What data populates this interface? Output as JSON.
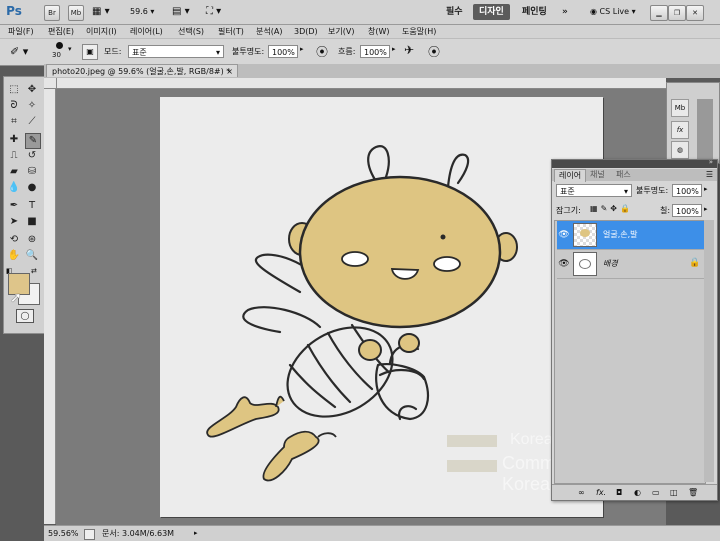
{
  "appbar": {
    "logo": "Ps",
    "br": "Br",
    "mb": "Mb",
    "zoom": "59.6",
    "workspaces": [
      "필수",
      "디자인",
      "페인팅"
    ],
    "active_workspace": "디자인",
    "more": "»",
    "cslive": "CS Live"
  },
  "menu": [
    "파일(F)",
    "편집(E)",
    "이미지(I)",
    "레이어(L)",
    "선택(S)",
    "필터(T)",
    "분석(A)",
    "3D(D)",
    "보기(V)",
    "창(W)",
    "도움말(H)"
  ],
  "options": {
    "brush_size": "30",
    "mode_label": "모드:",
    "mode_value": "표준",
    "opacity_label": "불투명도:",
    "opacity_value": "100%",
    "flow_label": "흐름:",
    "flow_value": "100%"
  },
  "document": {
    "tab_title": "photo20.jpeg @ 59.6% (얼굴,손,발, RGB/8#) *",
    "close": "×"
  },
  "status": {
    "zoom": "59.56%",
    "doc_size": "문서: 3.04M/6.63M"
  },
  "layers_panel": {
    "tabs": [
      "레이어",
      "채널",
      "패스"
    ],
    "blend_mode": "표준",
    "opacity_label": "불투명도:",
    "opacity_value": "100%",
    "lock_label": "잠그기:",
    "fill_label": "칠:",
    "fill_value": "100%",
    "layers": [
      {
        "name": "얼굴,손,발",
        "selected": true
      },
      {
        "name": "배경",
        "selected": false,
        "locked": true
      }
    ]
  },
  "watermark": {
    "line1": "Korea",
    "line2": "Commerce Korea"
  },
  "colors": {
    "foreground": "#dec58a",
    "background": "#f2f2f2",
    "fill_tan": "#dec582",
    "selected_row": "#3d8fe8"
  }
}
